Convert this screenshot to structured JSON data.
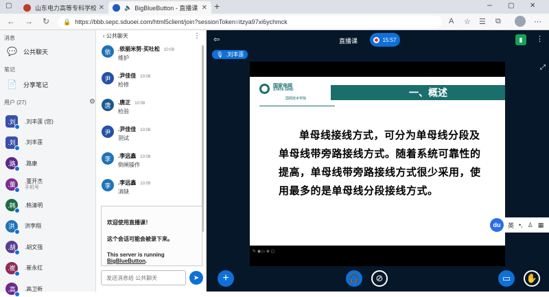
{
  "browser": {
    "tabs": [
      {
        "label": "山东电力高等专科学校",
        "active": false
      },
      {
        "label": "BigBlueButton - 直播课 - Dire",
        "active": true
      }
    ],
    "url": "https://bbb.sepc.sduoei.com/html5client/join?sessionToken=itzya97xi6ychmck"
  },
  "sidebar": {
    "messages_label": "消息",
    "public_chat_label": "公共聊天",
    "notes_label": "笔记",
    "shared_notes_label": "分享笔记",
    "users_label": "用户 (27)",
    "users": [
      {
        "initial": ".刘",
        "name": ".刘丰莲 (您)",
        "sub": "",
        "color": "#3a4fa8"
      },
      {
        "initial": ".刘",
        "name": ".刘丰莲",
        "sub": "",
        "color": "#3a4fa8"
      },
      {
        "initial": ".路",
        "name": ".路康",
        "sub": "",
        "color": "#5c2a87"
      },
      {
        "initial": ".董",
        "name": ".董开杰",
        "sub": "手机号",
        "color": "#7a2f8f"
      },
      {
        "initial": ".韩",
        "name": ".韩清明",
        "sub": "",
        "color": "#1e6b43"
      },
      {
        "initial": "洪",
        "name": "洪李翔",
        "sub": "",
        "color": "#1f73b7"
      },
      {
        "initial": ".胡",
        "name": ".胡文强",
        "sub": "",
        "color": "#5a3d8e"
      },
      {
        "initial": ".崔",
        "name": ".崔永红",
        "sub": "",
        "color": "#8e2a5a"
      },
      {
        "initial": ".高",
        "name": ".高卫新",
        "sub": "",
        "color": "#6b2a8e"
      }
    ]
  },
  "chat": {
    "header": "公共聊天",
    "messages": [
      {
        "initial": "依",
        "name": ".依丽米努·买吐松",
        "time": "10:08",
        "text": "维护",
        "color": "#1f73b7"
      },
      {
        "initial": "尹",
        "name": ".尹佳佳",
        "time": "10:08",
        "text": "检修",
        "color": "#2451a6"
      },
      {
        "initial": "唐",
        "name": ".唐正",
        "time": "10:08",
        "text": "检验",
        "color": "#1a5a8e"
      },
      {
        "initial": "尹",
        "name": ".尹佳佳",
        "time": "10:08",
        "text": "测试",
        "color": "#2451a6"
      },
      {
        "initial": "李",
        "name": ".李远鑫",
        "time": "10:08",
        "text": "倒闸操作",
        "color": "#1f73b7"
      },
      {
        "initial": "李",
        "name": ".李远鑫",
        "time": "10:09",
        "text": "消缺",
        "color": "#1f73b7"
      }
    ],
    "welcome": {
      "line1": "欢迎使用直播课！",
      "line2": "这个会话可能会被录下来。",
      "line3_prefix": "This server is running ",
      "line3_link": "BigBlueButton",
      "line3_suffix": "."
    },
    "input_placeholder": "发送消息给 公共聊天"
  },
  "main": {
    "room_title": "直播课",
    "record_time": "15:57",
    "talker": ".刘丰莲",
    "slide": {
      "banner": "一、概述",
      "logo_cn": "国家电网",
      "logo_en": "STATE GRID",
      "logo_sub": "国网技术学院",
      "body": "单母线接线方式，可分为单母线分段及单母线带旁路接线方式。随着系统可靠性的提高，单母线带旁路接线方式很少采用，使用最多的是单母线分段接线方式。"
    }
  },
  "ime": {
    "logo": "du",
    "lang": "英"
  },
  "colors": {
    "primary": "#0f70d7",
    "main_bg": "#06172a",
    "slide_banner": "#1a6f6d"
  }
}
